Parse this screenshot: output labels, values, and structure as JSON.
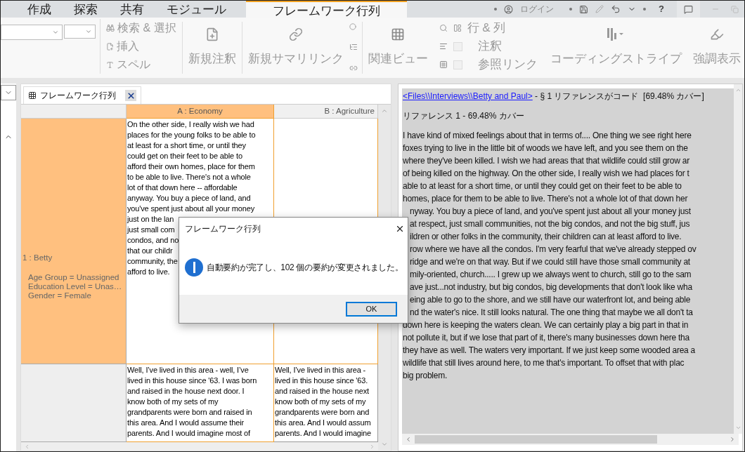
{
  "menu_tabs": [
    {
      "label": "作成",
      "selected": false
    },
    {
      "label": "探索",
      "selected": false
    },
    {
      "label": "共有",
      "selected": false
    },
    {
      "label": "モジュール",
      "selected": false
    },
    {
      "label": "フレームワーク行列",
      "selected": true
    }
  ],
  "title_bar": {
    "login": "ログイン",
    "help": "?"
  },
  "ribbon": {
    "find_select": "検索 & 選択",
    "insert": "挿入",
    "spell": "スペル",
    "new_annotation": "新規注釈",
    "new_summary_link": "新規サマリリンク",
    "related_views": "関連ビュー",
    "rows_columns": "行 & 列",
    "toggles": [
      {
        "label": "注釈",
        "checked": false
      },
      {
        "label": "参照リンク",
        "checked": false
      }
    ],
    "coding_stripes": "コーディングストライプ",
    "highlight": "強調表示"
  },
  "document_tab": {
    "label": "フレームワーク行列"
  },
  "matrix": {
    "columns": [
      {
        "label": "A : Economy",
        "selected": true
      },
      {
        "label": "B : Agriculture",
        "selected": false
      }
    ],
    "rows": [
      {
        "header": "1 : Betty",
        "attributes": [
          "Age Group = Unassigned",
          "Education Level = Unas…",
          "Gender = Female"
        ],
        "selected": true,
        "cells": [
          [
            "On the other side, I really wish we had",
            "places for the young folks to be able to",
            "at least for a short time, or until they",
            "could get on their feet to be able to",
            "afford their own homes, place for them",
            "to be able to live. There's not a whole",
            "lot of that down here -- affordable",
            "anyway. You buy a piece of land, and",
            "you've spent just about all your money",
            "just on the lan",
            "just small com",
            "condos, and no",
            "that our childr",
            "community, the",
            "afford to live."
          ],
          []
        ]
      },
      {
        "selected": false,
        "cells": [
          [
            "Well, I’ve lived in this area - well, I’ve",
            "lived in this house since '63. I was born",
            "and raised in the house next door. I",
            "know both of my sets of my",
            "grandparents were born and raised in",
            "this area. And I would assume their",
            "parents. And I would imagine most of"
          ],
          [
            "Well, I’ve lived in this area -",
            "lived in this house since '63.",
            "and raised in the house next",
            "know both of my sets of my",
            "grandparents were born and",
            "this area. And I would assum",
            "parents. And I would imagine"
          ]
        ]
      }
    ]
  },
  "reference": {
    "source_link": "<Files\\\\Interviews\\\\Betty and Paul>",
    "summary": " - § 1 リファレンスがコード  [69.48% カバー]",
    "heading": "リファレンス 1 - 69.48% カバー",
    "lines": [
      {
        "text": "I have kind of mixed feelings about that in terms of.... One thing we see right here",
        "covered": false
      },
      {
        "text": "foxes trying to live in the little bit of woods we have left, and you see them on the",
        "covered": false
      },
      {
        "text": "where they've been killed. I wish we had areas that that wildlife could still grow ar",
        "covered": false
      },
      {
        "text": "of being killed on the highway. On the other side, I really wish we had places for t",
        "covered": false
      },
      {
        "text": "able to at least for a short time, or until they could get on their feet to be able to",
        "covered": false
      },
      {
        "text": "homes, place for them to be able to live. There's not a whole lot of that down her",
        "covered": false
      },
      {
        "text": "nyway. You buy a piece of land, and you've spent just about all your money just",
        "covered": true
      },
      {
        "text": "at respect, just small communities, not the big condos, and not the big stuff, jus",
        "covered": true
      },
      {
        "text": "ildren or other folks in the community, their children can at least afford to live.",
        "covered": true
      },
      {
        "text": "row where we have all the condos. I'm very fearful that we've already stepped ov",
        "covered": true
      },
      {
        "text": "ridge and we're on that way. But if we could still have those small community at",
        "covered": true
      },
      {
        "text": "mily-oriented, church..... I grew up we always went to church, still go to the sam",
        "covered": true
      },
      {
        "text": "ave just...not industry, but big condos, big developments that don't look like wha",
        "covered": true
      },
      {
        "text": "eing able to go to the shore, and we still have our waterfront lot, and being able",
        "covered": true
      },
      {
        "text": "nd the water's nice. It still looks natural. The one thing that maybe we all don't ta",
        "covered": true
      },
      {
        "text": "down here is keeping the waters clean. We can certainly play a big part in that in",
        "covered": false
      },
      {
        "text": "not pollute it, but if we lose that part of it, there's many businesses down here tha",
        "covered": false
      },
      {
        "text": "they have as well. The waters very important. If we just keep some wooded area a",
        "covered": false
      },
      {
        "text": "wildlife that still lives around here, to me that's important. To offset that with plac",
        "covered": false
      },
      {
        "text": "big problem.",
        "covered": false
      }
    ]
  },
  "dialog": {
    "title": "フレームワーク行列",
    "message": "自動要約が完了し、102 個の要約が変更されました。",
    "button": "OK"
  }
}
